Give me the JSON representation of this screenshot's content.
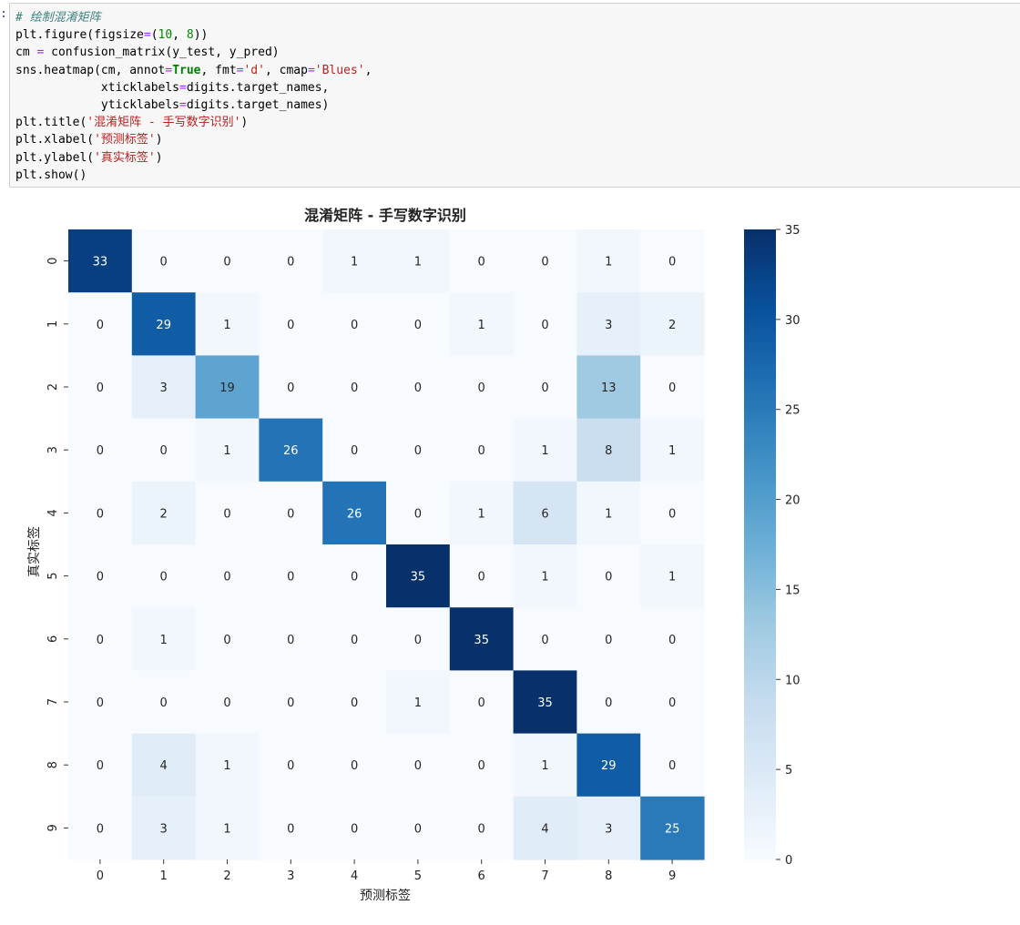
{
  "cell": {
    "prompt": ":",
    "lines": [
      [
        {
          "t": "# 绘制混淆矩阵",
          "c": "comment"
        }
      ],
      [
        {
          "t": "plt.figure(figsize"
        },
        {
          "t": "=",
          "c": "op"
        },
        {
          "t": "("
        },
        {
          "t": "10",
          "c": "num"
        },
        {
          "t": ", "
        },
        {
          "t": "8",
          "c": "num"
        },
        {
          "t": "))"
        }
      ],
      [
        {
          "t": "cm "
        },
        {
          "t": "=",
          "c": "op"
        },
        {
          "t": " confusion_matrix(y_test, y_pred)"
        }
      ],
      [
        {
          "t": "sns.heatmap(cm, annot"
        },
        {
          "t": "=",
          "c": "op"
        },
        {
          "t": "True",
          "c": "kw"
        },
        {
          "t": ", fmt"
        },
        {
          "t": "=",
          "c": "op"
        },
        {
          "t": "'d'",
          "c": "str"
        },
        {
          "t": ", cmap"
        },
        {
          "t": "=",
          "c": "op"
        },
        {
          "t": "'Blues'",
          "c": "str"
        },
        {
          "t": ","
        }
      ],
      [
        {
          "t": "            xticklabels"
        },
        {
          "t": "=",
          "c": "op"
        },
        {
          "t": "digits.target_names,"
        }
      ],
      [
        {
          "t": "            yticklabels"
        },
        {
          "t": "=",
          "c": "op"
        },
        {
          "t": "digits.target_names)"
        }
      ],
      [
        {
          "t": "plt.title("
        },
        {
          "t": "'混淆矩阵 - 手写数字识别'",
          "c": "str"
        },
        {
          "t": ")"
        }
      ],
      [
        {
          "t": "plt.xlabel("
        },
        {
          "t": "'预测标签'",
          "c": "str"
        },
        {
          "t": ")"
        }
      ],
      [
        {
          "t": "plt.ylabel("
        },
        {
          "t": "'真实标签'",
          "c": "str"
        },
        {
          "t": ")"
        }
      ],
      [
        {
          "t": "plt.show()"
        }
      ]
    ]
  },
  "chart_data": {
    "type": "heatmap",
    "title": "混淆矩阵 - 手写数字识别",
    "xlabel": "预测标签",
    "ylabel": "真实标签",
    "x_categories": [
      "0",
      "1",
      "2",
      "3",
      "4",
      "5",
      "6",
      "7",
      "8",
      "9"
    ],
    "y_categories": [
      "0",
      "1",
      "2",
      "3",
      "4",
      "5",
      "6",
      "7",
      "8",
      "9"
    ],
    "values": [
      [
        33,
        0,
        0,
        0,
        1,
        1,
        0,
        0,
        1,
        0
      ],
      [
        0,
        29,
        1,
        0,
        0,
        0,
        1,
        0,
        3,
        2
      ],
      [
        0,
        3,
        19,
        0,
        0,
        0,
        0,
        0,
        13,
        0
      ],
      [
        0,
        0,
        1,
        26,
        0,
        0,
        0,
        1,
        8,
        1
      ],
      [
        0,
        2,
        0,
        0,
        26,
        0,
        1,
        6,
        1,
        0
      ],
      [
        0,
        0,
        0,
        0,
        0,
        35,
        0,
        1,
        0,
        1
      ],
      [
        0,
        1,
        0,
        0,
        0,
        0,
        35,
        0,
        0,
        0
      ],
      [
        0,
        0,
        0,
        0,
        0,
        1,
        0,
        35,
        0,
        0
      ],
      [
        0,
        4,
        1,
        0,
        0,
        0,
        0,
        1,
        29,
        0
      ],
      [
        0,
        3,
        1,
        0,
        0,
        0,
        0,
        4,
        3,
        25
      ]
    ],
    "colormap": "Blues",
    "vmin": 0,
    "vmax": 35,
    "colorbar_ticks": [
      0,
      5,
      10,
      15,
      20,
      25,
      30,
      35
    ],
    "grid": false,
    "colorbar_position": "right"
  }
}
